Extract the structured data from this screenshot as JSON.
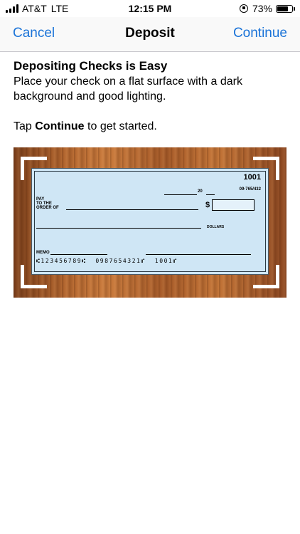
{
  "status_bar": {
    "carrier": "AT&T",
    "network": "LTE",
    "time": "12:15 PM",
    "battery": "73%",
    "battery_level": 0.73
  },
  "nav": {
    "cancel_label": "Cancel",
    "title": "Deposit",
    "continue_label": "Continue"
  },
  "content": {
    "heading": "Depositing Checks is Easy",
    "description": "Place your check on a flat surface with a dark background and good lighting.",
    "tap_prefix": "Tap ",
    "tap_bold": "Continue",
    "tap_suffix": " to get started."
  },
  "check": {
    "number": "1001",
    "routing_fraction": "09-765/432",
    "date_prefix": "20",
    "pay_to_line1": "PAY",
    "pay_to_line2": "TO THE",
    "pay_to_line3": "ORDER OF",
    "dollar_sign": "$",
    "dollars_label": "DOLLARS",
    "memo_label": "MEMO",
    "micr_line": "⑆123456789⑆  0987654321⑈  1001⑈"
  },
  "icons": {
    "signal": "signal-bars-icon",
    "orientation_lock": "orientation-lock-icon",
    "battery": "battery-icon"
  },
  "colors": {
    "accent": "#1a73d8",
    "check_background": "#cfe6f5"
  }
}
